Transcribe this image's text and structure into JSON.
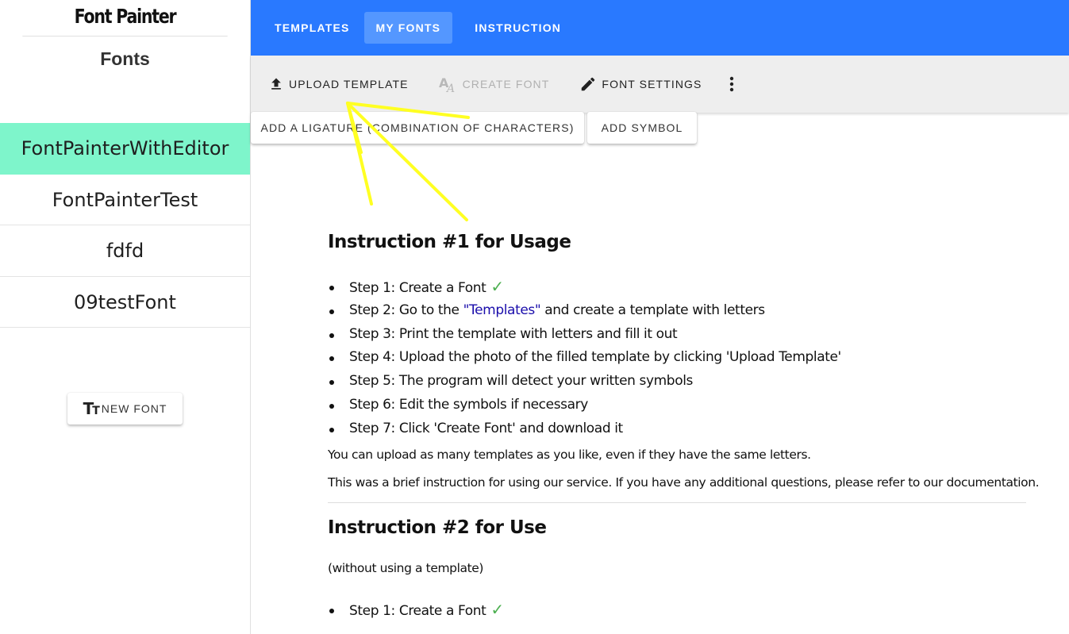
{
  "sidebar": {
    "app_title": "Font Painter",
    "fonts_heading": "Fonts",
    "fonts": [
      {
        "name": "FontPainterWithEditor",
        "active": true
      },
      {
        "name": "FontPainterTest",
        "active": false
      },
      {
        "name": "fdfd",
        "active": false
      },
      {
        "name": "09testFont",
        "active": false
      }
    ],
    "new_font_label": "NEW FONT",
    "new_font_icon": "text-fields-icon"
  },
  "nav": {
    "tabs": [
      {
        "label": "TEMPLATES",
        "active": false
      },
      {
        "label": "MY FONTS",
        "active": true
      },
      {
        "label": "INSTRUCTION",
        "active": false
      }
    ]
  },
  "toolbar": {
    "upload_template": {
      "label": "UPLOAD TEMPLATE",
      "icon": "upload-icon"
    },
    "create_font": {
      "label": "CREATE FONT",
      "icon": "font-a-icon",
      "disabled": true
    },
    "font_settings": {
      "label": "FONT SETTINGS",
      "icon": "pencil-icon"
    },
    "more_icon": "more-vert-icon"
  },
  "actions": {
    "add_ligature": "ADD A LIGATURE (COMBINATION OF CHARACTERS)",
    "add_symbol": "ADD SYMBOL"
  },
  "instructions": {
    "section1": {
      "title": "Instruction #1 for Usage",
      "step1": "Step 1: Create a Font",
      "step2_prefix": "Step 2: Go to the ",
      "step2_link": "\"Templates\"",
      "step2_suffix": " and create a template with letters",
      "step3": "Step 3: Print the template with letters and fill it out",
      "step4": "Step 4: Upload the photo of the filled template by clicking 'Upload Template'",
      "step5": "Step 5: The program will detect your written symbols",
      "step6": "Step 6: Edit the symbols if necessary",
      "step7": "Step 7: Click 'Create Font' and download it",
      "note1": "You can upload as many templates as you like, even if they have the same letters.",
      "note2": "This was a brief instruction for using our service. If you have any additional questions, please refer to our documentation."
    },
    "section2": {
      "title": "Instruction #2 for Use",
      "subtitle": "(without using a template)",
      "step1": "Step 1: Create a Font"
    },
    "check_glyph": "✓"
  },
  "colors": {
    "nav_blue": "#2979ff",
    "active_tab": "#5497ff",
    "active_font": "#7ef5cb",
    "toolbar_bg": "#eeeeee",
    "arrow": "#ffff22",
    "check": "#4caf50",
    "link": "#1a0dab"
  }
}
